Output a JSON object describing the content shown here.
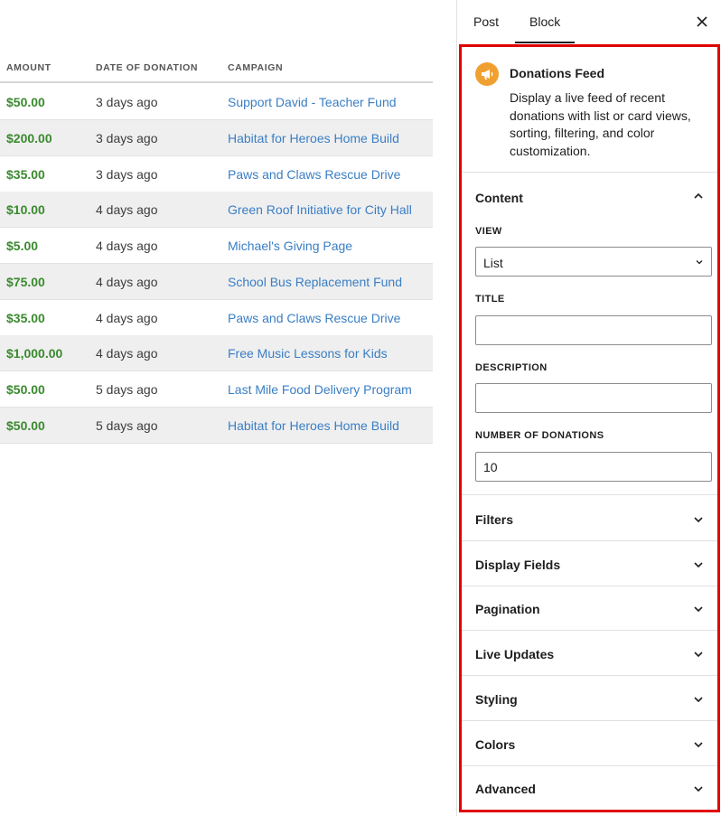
{
  "table": {
    "headers": {
      "amount": "AMOUNT",
      "date": "DATE OF DONATION",
      "campaign": "CAMPAIGN"
    },
    "rows": [
      {
        "amount": "$50.00",
        "date": "3 days ago",
        "campaign": "Support David - Teacher Fund"
      },
      {
        "amount": "$200.00",
        "date": "3 days ago",
        "campaign": "Habitat for Heroes Home Build"
      },
      {
        "amount": "$35.00",
        "date": "3 days ago",
        "campaign": "Paws and Claws Rescue Drive"
      },
      {
        "amount": "$10.00",
        "date": "4 days ago",
        "campaign": "Green Roof Initiative for City Hall"
      },
      {
        "amount": "$5.00",
        "date": "4 days ago",
        "campaign": "Michael's Giving Page"
      },
      {
        "amount": "$75.00",
        "date": "4 days ago",
        "campaign": "School Bus Replacement Fund"
      },
      {
        "amount": "$35.00",
        "date": "4 days ago",
        "campaign": "Paws and Claws Rescue Drive"
      },
      {
        "amount": "$1,000.00",
        "date": "4 days ago",
        "campaign": "Free Music Lessons for Kids"
      },
      {
        "amount": "$50.00",
        "date": "5 days ago",
        "campaign": "Last Mile Food Delivery Program"
      },
      {
        "amount": "$50.00",
        "date": "5 days ago",
        "campaign": "Habitat for Heroes Home Build"
      }
    ]
  },
  "sidebar": {
    "tabs": {
      "post": "Post",
      "block": "Block"
    },
    "close_icon": "close-icon",
    "block": {
      "icon": "megaphone-icon",
      "title": "Donations Feed",
      "description": "Display a live feed of recent donations with list or card views, sorting, filtering, and color customization."
    },
    "content": {
      "title": "Content",
      "view_label": "VIEW",
      "view_value": "List",
      "title_label": "TITLE",
      "title_value": "",
      "description_label": "DESCRIPTION",
      "description_value": "",
      "number_label": "NUMBER OF DONATIONS",
      "number_value": "10"
    },
    "sections": [
      "Filters",
      "Display Fields",
      "Pagination",
      "Live Updates",
      "Styling",
      "Colors",
      "Advanced"
    ]
  },
  "colors": {
    "amount": "#3a8a2e",
    "link": "#3a7ec4",
    "highlight_border": "#e00000",
    "block_icon_bg": "#f0a030"
  }
}
